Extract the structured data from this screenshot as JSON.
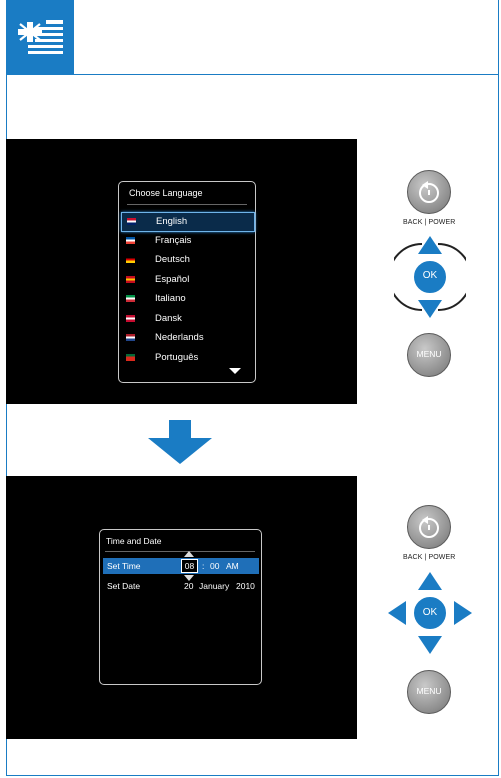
{
  "colors": {
    "accent": "#1a7cc4",
    "screen_bg": "#000000",
    "selected": "#1f6fb8"
  },
  "header": {
    "icon": "uk-us-flag-icon"
  },
  "step1": {
    "menu_title": "Choose  Language",
    "languages": [
      {
        "label": "English",
        "flag": "uk",
        "selected": true
      },
      {
        "label": "Français",
        "flag": "fr",
        "selected": false
      },
      {
        "label": "Deutsch",
        "flag": "de",
        "selected": false
      },
      {
        "label": "Español",
        "flag": "es",
        "selected": false
      },
      {
        "label": "Italiano",
        "flag": "it",
        "selected": false
      },
      {
        "label": "Dansk",
        "flag": "dk",
        "selected": false
      },
      {
        "label": "Nederlands",
        "flag": "nl",
        "selected": false
      },
      {
        "label": "Português",
        "flag": "pt",
        "selected": false
      }
    ],
    "buttons": {
      "back_caption": "BACK | POWER",
      "ok_label": "OK",
      "menu_label": "MENU"
    }
  },
  "step2": {
    "menu_title": "Time and Date",
    "set_time_label": "Set Time",
    "time_hour": "08",
    "time_sep": ":",
    "time_min": "00",
    "time_ampm": "AM",
    "set_date_label": "Set Date",
    "date_day": "20",
    "date_month": "January",
    "date_year": "2010",
    "buttons": {
      "back_caption": "BACK | POWER",
      "ok_label": "OK",
      "menu_label": "MENU"
    }
  }
}
